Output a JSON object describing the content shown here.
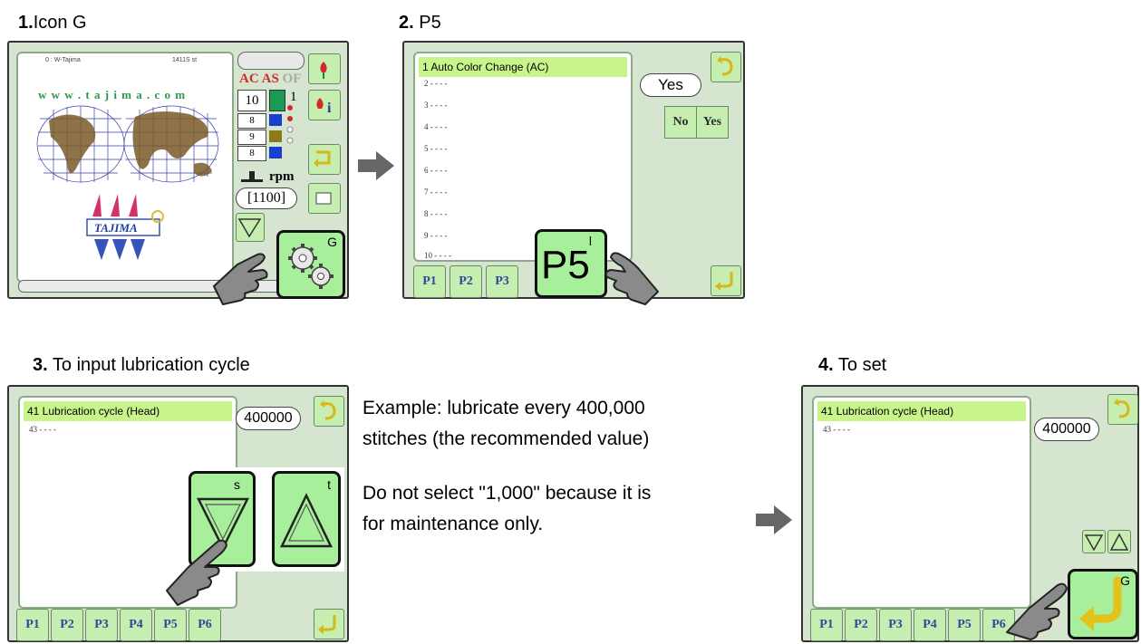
{
  "steps": [
    {
      "num": "1.",
      "label": "Icon G"
    },
    {
      "num": "2.",
      "label": " P5"
    },
    {
      "num": "3.",
      "label": " To input lubrication cycle"
    },
    {
      "num": "4.",
      "label": " To set"
    }
  ],
  "screen1": {
    "header_left": "0 : W-Tajima",
    "header_right": "1411S st",
    "website": "w w w . t a j i m a . c o m",
    "brand": "TAJIMA",
    "mode_labels": [
      "AC",
      "AS",
      "OF"
    ],
    "needle_values": [
      "10",
      "8",
      "9",
      "8"
    ],
    "count_one": "1",
    "rpm_label": "rpm",
    "speed_value": "[1100]",
    "big_button_letter": "G"
  },
  "screen2": {
    "list_header": "1 Auto Color Change (AC)",
    "list_rows": [
      "2 - - - -",
      "3 - - - -",
      "4 - - - -",
      "5 - - - -",
      "6 - - - -",
      "7 - - - -",
      "8 - - - -",
      "9 - - - -",
      "10 - - - -"
    ],
    "value_pill": "Yes",
    "no_button": "No",
    "yes_button": "Yes",
    "tabs": [
      "P1",
      "P2",
      "P3"
    ],
    "big_button_label": "P5",
    "big_button_letter": "l"
  },
  "screen3": {
    "list_header": "41 Lubrication cycle (Head)",
    "list_rows": [
      "43 - - - -"
    ],
    "value_pill": "400000",
    "tabs": [
      "P1",
      "P2",
      "P3",
      "P4",
      "P5",
      "P6"
    ],
    "down_letter": "s",
    "up_letter": "t"
  },
  "description": {
    "line1": "Example: lubricate every 400,000",
    "line2": "stitches (the recommended value)",
    "line3": "Do not select \"1,000\" because it is",
    "line4": "for maintenance only."
  },
  "screen4": {
    "list_header": "41 Lubrication cycle (Head)",
    "list_rows": [
      "43 - - - -"
    ],
    "value_pill": "400000",
    "tabs": [
      "P1",
      "P2",
      "P3",
      "P4",
      "P5",
      "P6"
    ],
    "big_button_letter": "G"
  },
  "colors": {
    "panel_bg": "#d6e5cf",
    "highlight": "#c7f48b",
    "button_green": "#c6eeb0",
    "big_button": "#a7ef9a",
    "arrow_gray": "#666666"
  }
}
